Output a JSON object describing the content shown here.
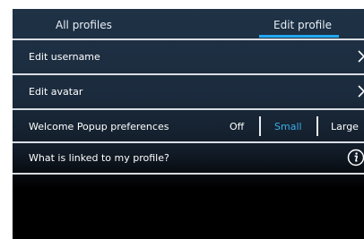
{
  "tabs": [
    {
      "label": "All profiles",
      "active": false
    },
    {
      "label": "Edit profile",
      "active": true
    }
  ],
  "rows": {
    "username": {
      "label": "Edit username",
      "icon": "chevron-right-icon"
    },
    "avatar": {
      "label": "Edit avatar",
      "icon": "chevron-right-icon"
    },
    "popup": {
      "label": "Welcome Popup preferences",
      "options": [
        "Off",
        "Small",
        "Large"
      ],
      "selected": "Small"
    },
    "linked": {
      "label": "What is linked to my profile?",
      "icon": "info-icon"
    }
  },
  "colors": {
    "accent": "#23aaf2",
    "selected_option": "#3aaee8",
    "text": "#ffffff"
  }
}
